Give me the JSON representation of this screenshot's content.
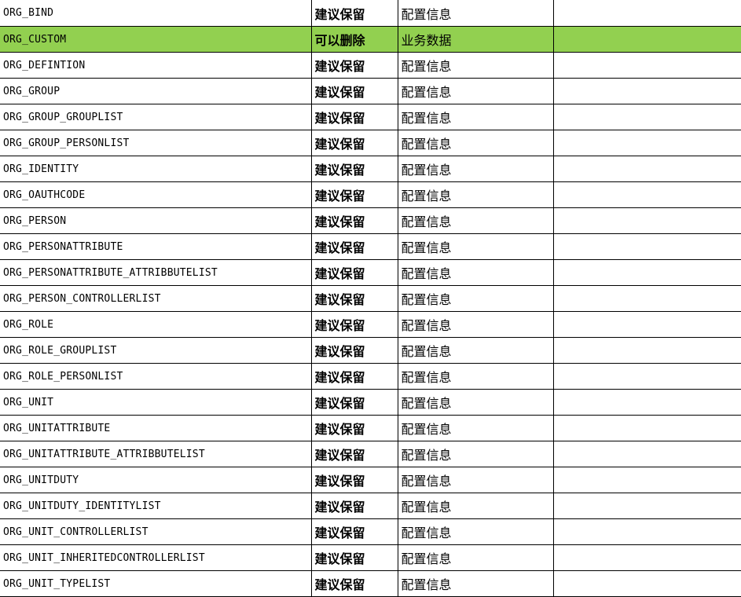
{
  "colors": {
    "highlight": "#92d050",
    "grid": "#000000"
  },
  "rows": [
    {
      "table": "ORG_BIND",
      "action": "建议保留",
      "category": "配置信息",
      "note": ""
    },
    {
      "table": "ORG_CUSTOM",
      "action": "可以删除",
      "category": "业务数据",
      "note": "",
      "highlight": true
    },
    {
      "table": "ORG_DEFINTION",
      "action": "建议保留",
      "category": "配置信息",
      "note": ""
    },
    {
      "table": "ORG_GROUP",
      "action": "建议保留",
      "category": "配置信息",
      "note": ""
    },
    {
      "table": "ORG_GROUP_GROUPLIST",
      "action": "建议保留",
      "category": "配置信息",
      "note": ""
    },
    {
      "table": "ORG_GROUP_PERSONLIST",
      "action": "建议保留",
      "category": "配置信息",
      "note": ""
    },
    {
      "table": "ORG_IDENTITY",
      "action": "建议保留",
      "category": "配置信息",
      "note": ""
    },
    {
      "table": "ORG_OAUTHCODE",
      "action": "建议保留",
      "category": "配置信息",
      "note": ""
    },
    {
      "table": "ORG_PERSON",
      "action": "建议保留",
      "category": "配置信息",
      "note": ""
    },
    {
      "table": "ORG_PERSONATTRIBUTE",
      "action": "建议保留",
      "category": "配置信息",
      "note": ""
    },
    {
      "table": "ORG_PERSONATTRIBUTE_ATTRIBBUTELIST",
      "action": "建议保留",
      "category": "配置信息",
      "note": ""
    },
    {
      "table": "ORG_PERSON_CONTROLLERLIST",
      "action": "建议保留",
      "category": "配置信息",
      "note": ""
    },
    {
      "table": "ORG_ROLE",
      "action": "建议保留",
      "category": "配置信息",
      "note": ""
    },
    {
      "table": "ORG_ROLE_GROUPLIST",
      "action": "建议保留",
      "category": "配置信息",
      "note": ""
    },
    {
      "table": "ORG_ROLE_PERSONLIST",
      "action": "建议保留",
      "category": "配置信息",
      "note": ""
    },
    {
      "table": "ORG_UNIT",
      "action": "建议保留",
      "category": "配置信息",
      "note": ""
    },
    {
      "table": "ORG_UNITATTRIBUTE",
      "action": "建议保留",
      "category": "配置信息",
      "note": ""
    },
    {
      "table": "ORG_UNITATTRIBUTE_ATTRIBBUTELIST",
      "action": "建议保留",
      "category": "配置信息",
      "note": ""
    },
    {
      "table": "ORG_UNITDUTY",
      "action": "建议保留",
      "category": "配置信息",
      "note": ""
    },
    {
      "table": "ORG_UNITDUTY_IDENTITYLIST",
      "action": "建议保留",
      "category": "配置信息",
      "note": ""
    },
    {
      "table": "ORG_UNIT_CONTROLLERLIST",
      "action": "建议保留",
      "category": "配置信息",
      "note": ""
    },
    {
      "table": "ORG_UNIT_INHERITEDCONTROLLERLIST",
      "action": "建议保留",
      "category": "配置信息",
      "note": ""
    },
    {
      "table": "ORG_UNIT_TYPELIST",
      "action": "建议保留",
      "category": "配置信息",
      "note": ""
    }
  ]
}
